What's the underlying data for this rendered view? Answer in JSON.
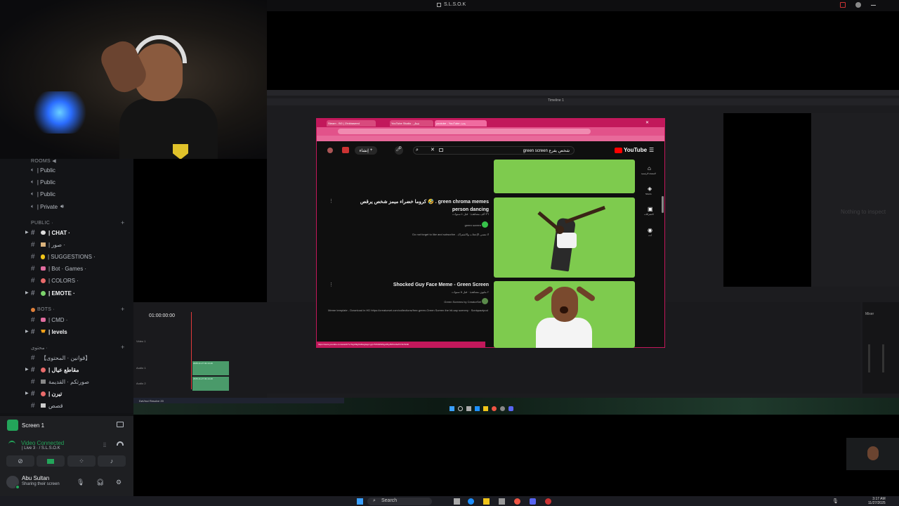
{
  "window_title": "S.L.S.O.K",
  "discord": {
    "categories": {
      "rooms": "ROOMS ◀",
      "public": "PUBLIC ·",
      "bots": "BOTS ·",
      "content": "محتوى ·"
    },
    "voice_channels": [
      {
        "label": "| Public"
      },
      {
        "label": "| Public"
      },
      {
        "label": "| Public"
      },
      {
        "label": "| Private"
      }
    ],
    "public_channels": [
      {
        "label": "| CHAT ·",
        "bold": true
      },
      {
        "label": "| صور ·",
        "bold": false
      },
      {
        "label": "| SUGGESTIONS ·",
        "bold": false
      },
      {
        "label": "| Bot · Games ·",
        "bold": false
      },
      {
        "label": "| COLORS ·",
        "bold": false
      },
      {
        "label": "| EMOTE ·",
        "bold": true
      }
    ],
    "bot_channels": [
      {
        "label": "| CMD ·"
      },
      {
        "label": "| levels"
      }
    ],
    "content_channels": [
      {
        "label": "【قوانين · المحتوى】"
      },
      {
        "label": "| مقاطع عيال"
      },
      {
        "label": "صورتكم · القديمة"
      },
      {
        "label": "| تيرن"
      },
      {
        "label": "قصص"
      }
    ],
    "screen_share": {
      "label": "Screen 1"
    },
    "voice": {
      "status": "Video Connected",
      "channel": "| Live 3 · / S.L.S.O.K"
    },
    "user": {
      "name": "Abu Sultan",
      "status": "Sharing their screen"
    }
  },
  "browser": {
    "tabs": [
      "Steam - BG | Zinkbaseed",
      "YouTube Studio - شعار",
      "youtube - YouTube بحث"
    ],
    "youtube": {
      "logo": "YouTube",
      "search_query": "green screen شخص يقرع",
      "create_label": "إنشاء",
      "sidebar": [
        "الصفحة الرئيسية",
        "Shorts",
        "الاشتراكات",
        "أنت"
      ],
      "results": [
        {
          "title": "كروما خضراء ميمز شخص يرقص 🤣 . green chroma memes person dancing",
          "meta": "٣٦ ألف مشاهدة · قبل ٤ سنوات",
          "channel": "green screen",
          "desc": "Do not forget to like and subscribe . لا تنسى الإعجاب والاشتراك"
        },
        {
          "title": "Shocked Guy Face Meme - Green Screen",
          "meta": "٢ مليون مشاهدة · قبل ٥ سنوات",
          "channel": "Green Screens by CreatorSet",
          "desc": "Meme template - Download in HD https://creatorset.com/collections/free-green-Green Screen the hit-say scenery · Soniquazipod"
        }
      ],
      "status_url": "https://www.youtube.com/watch?v=NgUi9ghGRwg&pp=ygUTZ3JlZW4gc2NyZWVuIGZhY2U%3D"
    }
  },
  "resolve": {
    "timecode": "01:00:00:00",
    "nothing_label": "Nothing to inspect",
    "track_labels": [
      "Video 1",
      "Audio 1",
      "Audio 2"
    ],
    "clips": [
      "2025-11-27 00-13-40",
      "2025-11-27 00-13-40"
    ],
    "product": "DaVinci Resolve 20",
    "timeline_name": "Timeline 1",
    "mixer_label": "Mixer"
  },
  "taskbar": {
    "search_label": "Search",
    "time": "3:17 AM",
    "date": "11/27/2025"
  },
  "colors": {
    "accent_discord_green": "#23a55a",
    "youtube_red": "#ff0000",
    "green_screen": "#7ecb4e",
    "browser_frame": "#c2185b"
  }
}
